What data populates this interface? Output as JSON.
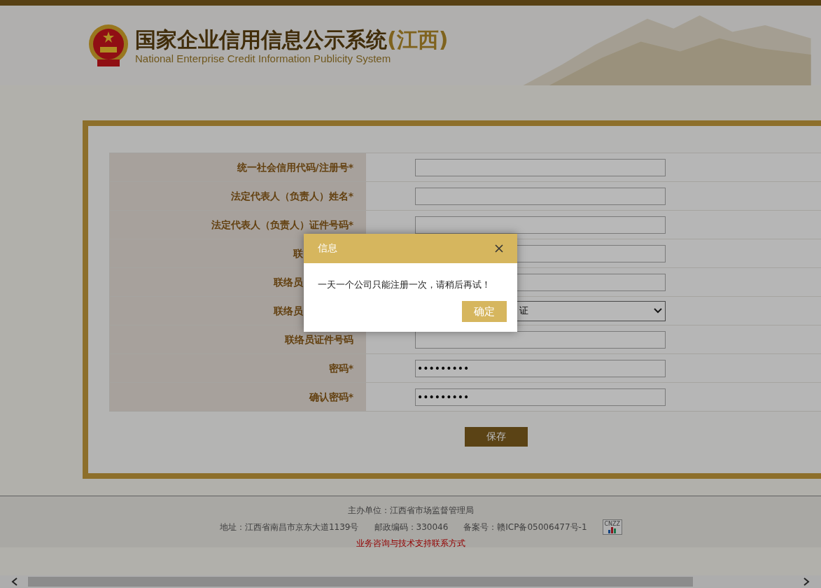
{
  "header": {
    "title": "国家企业信用信息公示系统",
    "region": "(江西)",
    "subtitle": "National Enterprise Credit Information Publicity System"
  },
  "form": {
    "rows": [
      {
        "label": "统一社会信用代码/注册号*",
        "kind": "input"
      },
      {
        "label": "法定代表人（负责人）姓名*",
        "kind": "input"
      },
      {
        "label": "法定代表人（负责人）证件号码*",
        "kind": "input"
      },
      {
        "label": "联",
        "kind": "input"
      },
      {
        "label": "联络员",
        "kind": "input"
      },
      {
        "label": "联络员",
        "kind": "select",
        "value": "证"
      },
      {
        "label": "联络员证件号码",
        "kind": "input"
      },
      {
        "label": "密码*",
        "kind": "input",
        "value": "•••••••••"
      },
      {
        "label": "确认密码*",
        "kind": "input",
        "value": "•••••••••"
      }
    ],
    "save_button": "保存"
  },
  "footer": {
    "sponsor": "主办单位：江西省市场监督管理局",
    "address": "地址：江西省南昌市京东大道1139号",
    "postcode": "邮政编码：330046",
    "icp": "备案号：赣ICP备05006477号-1",
    "counter_badge": "CNZZ",
    "contact_link": "业务咨询与技术支持联系方式"
  },
  "dialog": {
    "title": "信息",
    "message": "一天一个公司只能注册一次，请稍后再试！",
    "confirm_button": "确定"
  }
}
